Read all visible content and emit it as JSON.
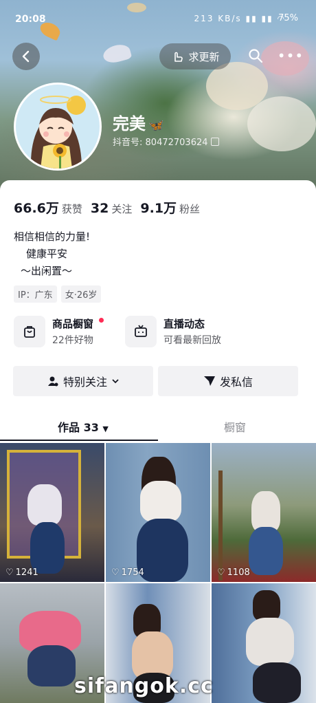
{
  "status_bar": {
    "time": "20:08",
    "network": "213 KB/s",
    "battery": "75%"
  },
  "header": {
    "request_update_label": "求更新"
  },
  "profile": {
    "nickname": "完美",
    "nickname_emoji": "🦋",
    "douyin_id_label": "抖音号:",
    "douyin_id": "80472703624"
  },
  "stats": [
    {
      "num": "66.6万",
      "label": "获赞"
    },
    {
      "num": "32",
      "label": "关注"
    },
    {
      "num": "9.1万",
      "label": "粉丝"
    }
  ],
  "bio": {
    "line1": "相信相信的力量!",
    "line2": "健康平安",
    "line3": "～出闲置～"
  },
  "tags": [
    "IP：广东",
    "女·26岁"
  ],
  "features": {
    "shop": {
      "title": "商品橱窗",
      "sub": "22件好物"
    },
    "live": {
      "title": "直播动态",
      "sub": "可看最新回放"
    }
  },
  "buttons": {
    "follow": "特别关注",
    "message": "发私信"
  },
  "tabs": {
    "works": "作品 33",
    "showcase": "橱窗"
  },
  "grid": [
    {
      "likes": "1241"
    },
    {
      "likes": "1754"
    },
    {
      "likes": "1108"
    },
    {
      "likes": ""
    },
    {
      "likes": ""
    },
    {
      "likes": ""
    }
  ],
  "watermark": "sifangok.cc",
  "colors": {
    "accent": "#fe2c55",
    "text": "#161823",
    "muted": "#5a5b61"
  }
}
